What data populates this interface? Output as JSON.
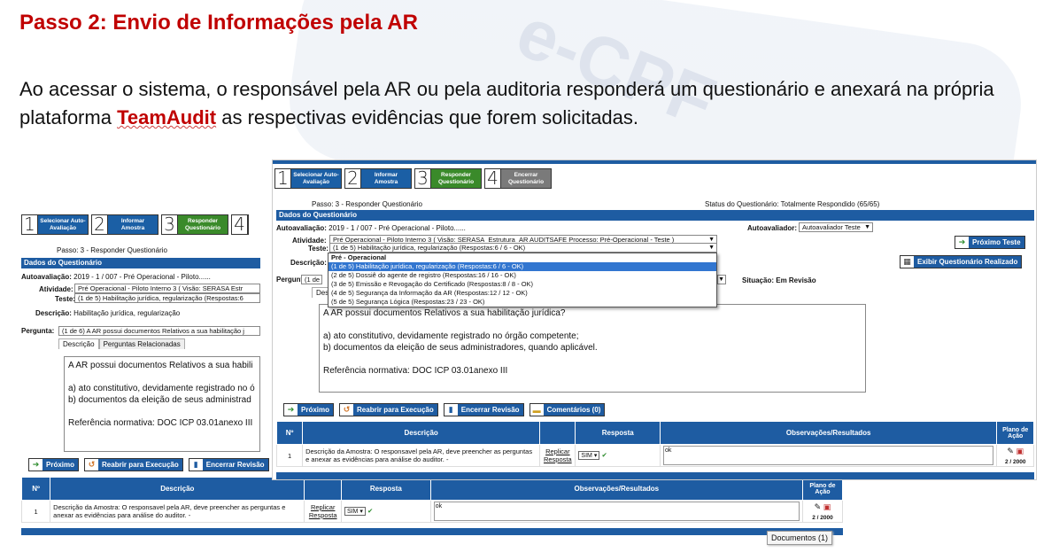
{
  "slide": {
    "title": "Passo 2: Envio de Informações pela AR",
    "body_before": "Ao acessar o sistema, o responsável pela AR ou pela auditoria responderá um questionário e anexará na própria plataforma ",
    "brand": "TeamAudit",
    "body_after": " as respectivas evidências que forem solicitadas."
  },
  "watermark": "e-CPF",
  "steps": [
    {
      "num": "1",
      "label": "Selecionar Auto-Avaliação",
      "color": "#1b5fa5"
    },
    {
      "num": "2",
      "label": "Informar Amostra",
      "color": "#1b5fa5"
    },
    {
      "num": "3",
      "label": "Responder Questionário",
      "color": "#3a8a2a"
    },
    {
      "num": "4",
      "label": "Encerrar Questionário",
      "color": "#7a7a7a"
    }
  ],
  "back": {
    "step_caption": "Passo: 3 - Responder Questionário",
    "section": "Dados do Questionário",
    "autoavaliacao_label": "Autoavaliação:",
    "autoavaliacao_value": "2019 - 1 / 007 - Pré Operacional - Piloto......",
    "atividade_label": "Atividade:",
    "atividade_value": "Pré Operacional - Piloto Interno 3 ( Visão: SERASA Estr",
    "teste_label": "Teste:",
    "teste_value": "(1 de 5) Habilitação jurídica, regularização (Respostas:6",
    "descricao_label": "Descrição:",
    "descricao_value": "Habilitação jurídica, regularização",
    "pergunta_label": "Pergunta:",
    "pergunta_value": "(1 de 6) A AR possui documentos Relativos a sua habilitação j",
    "tab_desc": "Descrição",
    "tab_rel": "Perguntas Relacionadas",
    "text": "A AR possui documentos Relativos a sua habili\n\na) ato constitutivo, devidamente registrado no ó\nb) documentos da eleição de seus administrad\n\nReferência normativa: DOC ICP 03.01anexo III",
    "buttons": [
      "Próximo",
      "Reabrir para Execução",
      "Encerrar Revisão"
    ],
    "table": {
      "headers": [
        "Nº",
        "Descrição",
        "",
        "Resposta",
        "Observações/Resultados",
        "Plano de Ação"
      ],
      "row": {
        "num": "1",
        "desc": "Descrição da Amostra: O responsavel pela AR, deve preencher as perguntas e anexar as evidências para análise do auditor. -",
        "replicar": "Replicar Resposta",
        "resposta": "SIM",
        "obs": "ok",
        "counter": "2 / 2000"
      }
    },
    "tooltip": "Documentos (1)"
  },
  "front": {
    "step_caption": "Passo: 3 - Responder Questionário",
    "status": "Status do Questionário: Totalmente Respondido (65/65)",
    "section": "Dados do Questionário",
    "autoavaliacao_label": "Autoavaliação:",
    "autoavaliacao_value": "2019 - 1 / 007 - Pré Operacional - Piloto......",
    "autoavaliador_label": "Autoavaliador:",
    "autoavaliador_value": "Autoavaliador Teste",
    "atividade_label": "Atividade:",
    "atividade_value": "Pré Operacional - Piloto Interno 3 ( Visão: SERASA_Estrutura_AR AUDITSAFE  Processo: Pré-Operacional - Teste )",
    "teste_label": "Teste:",
    "teste_value": "(1 de 5) Habilitação jurídica, regularização (Respostas:6 / 6 - OK)",
    "descricao_label": "Descrição:",
    "pergunta_label": "Pergunta:",
    "pergunta_partial": "(1 de",
    "tab_partial": "Des",
    "situacao": "Situação: Em Revisão",
    "btn_proximo_teste": "Próximo Teste",
    "btn_exibir": "Exibir Questionário Realizado",
    "dropdown": {
      "group": "Pré - Operacional",
      "options": [
        "(1 de 5) Habilitação jurídica, regularização (Respostas:6 / 6 - OK)",
        "(2 de 5) Dossiê do agente de registro (Respostas:16 / 16 - OK)",
        "(3 de 5) Emissão e Revogação do Certificado (Respostas:8 / 8 - OK)",
        "(4 de 5) Segurança da Informação da AR (Respostas:12 / 12 - OK)",
        "(5 de 5) Segurança Lógica (Respostas:23 / 23 - OK)"
      ]
    },
    "text": "A AR possui documentos Relativos a sua habilitação jurídica?\n\na) ato constitutivo, devidamente registrado no órgão competente;\nb) documentos da eleição de seus administradores, quando aplicável.\n\nReferência normativa: DOC ICP 03.01anexo III",
    "buttons": [
      "Próximo",
      "Reabrir para Execução",
      "Encerrar Revisão",
      "Comentários (0)"
    ],
    "table": {
      "headers": [
        "Nº",
        "Descrição",
        "",
        "Resposta",
        "Observações/Resultados",
        "Plano de Ação"
      ],
      "row": {
        "num": "1",
        "desc": "Descrição da Amostra: O responsavel pela AR, deve preencher as perguntas e anexar as evidências para análise do auditor. -",
        "replicar": "Replicar Resposta",
        "resposta": "SIM",
        "obs": "ok",
        "counter": "2 / 2000"
      }
    }
  },
  "colors": {
    "title_red": "#c00000",
    "header_blue": "#1e5ca2",
    "highlight_blue": "#3276d0"
  }
}
